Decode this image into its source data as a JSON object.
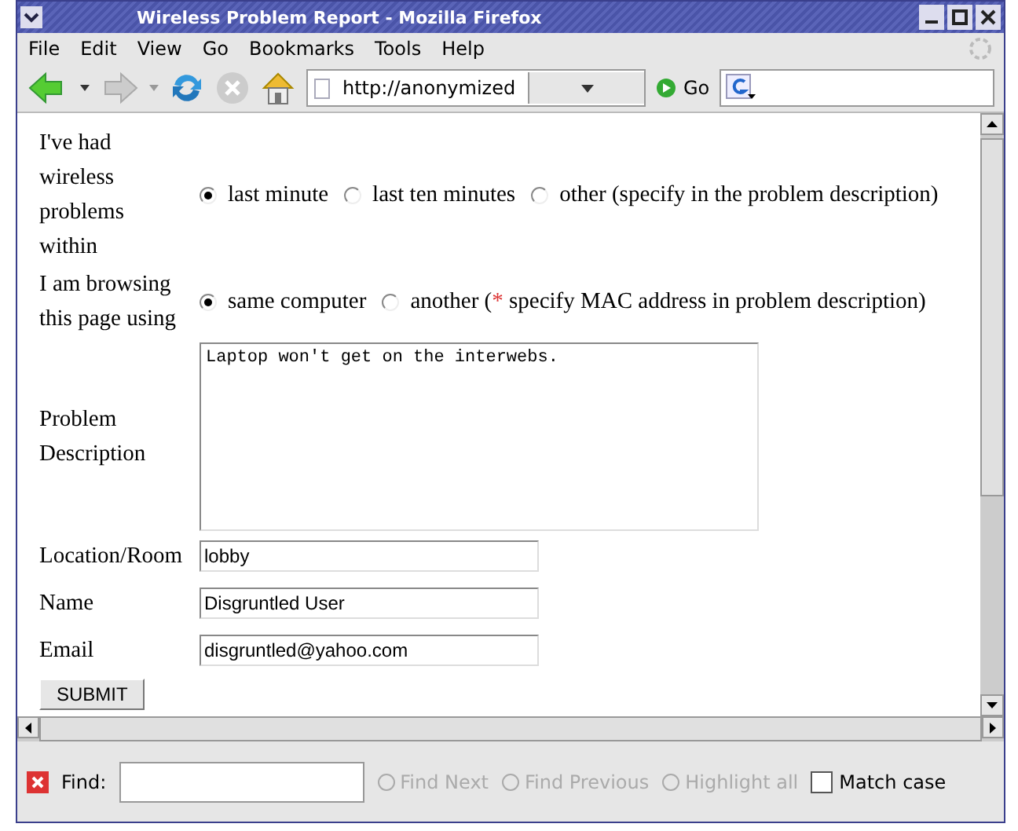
{
  "window": {
    "title": "Wireless Problem Report - Mozilla Firefox"
  },
  "menu": [
    "File",
    "Edit",
    "View",
    "Go",
    "Bookmarks",
    "Tools",
    "Help"
  ],
  "toolbar": {
    "url": "http://anonymized",
    "go_label": "Go"
  },
  "form": {
    "rows": [
      {
        "kind": "radio",
        "label": "I've had wireless problems within",
        "options": [
          {
            "label": "last minute",
            "selected": true
          },
          {
            "label": "last ten minutes",
            "selected": false
          },
          {
            "label": "other (specify in the problem description)",
            "selected": false
          }
        ]
      },
      {
        "kind": "radio",
        "label": "I am browsing this page using",
        "options": [
          {
            "label": "same computer",
            "selected": true
          },
          {
            "label": "another (",
            "mark": "*",
            "rest": " specify MAC address in problem description)",
            "selected": false
          }
        ]
      },
      {
        "kind": "textarea",
        "label": "Problem Description",
        "value": "Laptop won't get on the interwebs."
      },
      {
        "kind": "text",
        "label": "Location/Room",
        "value": "lobby"
      },
      {
        "kind": "text",
        "label": "Name",
        "value": "Disgruntled User"
      },
      {
        "kind": "text",
        "label": "Email",
        "value": "disgruntled@yahoo.com"
      }
    ],
    "submit": "SUBMIT"
  },
  "findbar": {
    "label": "Find:",
    "buttons": [
      {
        "label": "Find Next",
        "disabled": true
      },
      {
        "label": "Find Previous",
        "disabled": true
      },
      {
        "label": "Highlight all",
        "disabled": true
      }
    ],
    "match_case": {
      "label": "Match case",
      "checked": false
    }
  }
}
